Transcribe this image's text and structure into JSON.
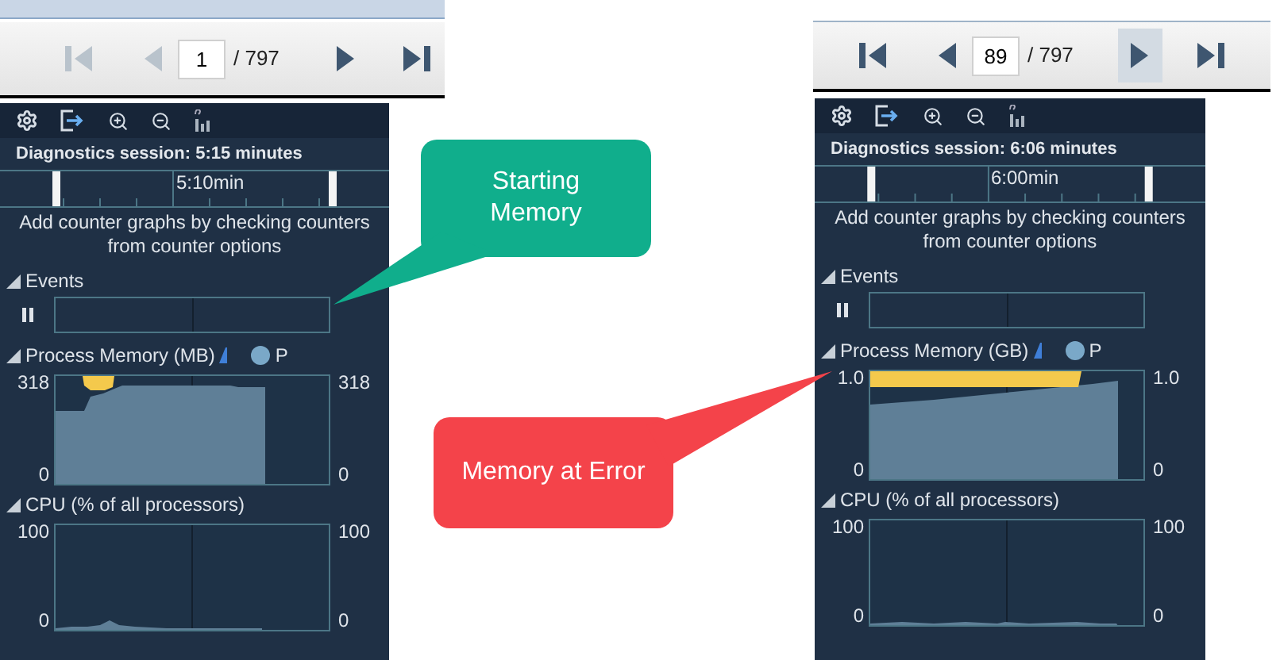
{
  "panels": [
    {
      "pager": {
        "page": "1",
        "total": "/ 797",
        "buttons": [
          {
            "kind": "first",
            "disabled": true,
            "highlighted": false
          },
          {
            "kind": "prev",
            "disabled": true,
            "highlighted": false
          },
          {
            "kind": "next",
            "disabled": false,
            "highlighted": false
          },
          {
            "kind": "last",
            "disabled": false,
            "highlighted": false
          }
        ]
      },
      "session": "Diagnostics session: 5:15 minutes",
      "timeline_label": "5:10min",
      "hint": "Add counter graphs by checking counters from counter options",
      "events_title": "Events",
      "graphs": [
        {
          "kind": "memory",
          "title": "Process Memory (MB)",
          "legend": "P",
          "left_max": "318",
          "left_min": "0",
          "right_max": "318",
          "right_min": "0"
        },
        {
          "kind": "cpu",
          "title": "CPU (% of all processors)",
          "left_max": "100",
          "left_min": "0",
          "right_max": "100",
          "right_min": "0"
        }
      ]
    },
    {
      "pager": {
        "page": "89",
        "total": "/ 797",
        "buttons": [
          {
            "kind": "first",
            "disabled": false,
            "highlighted": false
          },
          {
            "kind": "prev",
            "disabled": false,
            "highlighted": false
          },
          {
            "kind": "next",
            "disabled": false,
            "highlighted": true
          },
          {
            "kind": "last",
            "disabled": false,
            "highlighted": false
          }
        ]
      },
      "session": "Diagnostics session: 6:06 minutes",
      "timeline_label": "6:00min",
      "hint": "Add counter graphs by checking counters from counter options",
      "events_title": "Events",
      "graphs": [
        {
          "kind": "memory",
          "title": "Process Memory (GB)",
          "legend": "P",
          "left_max": "1.0",
          "left_min": "0",
          "right_max": "1.0",
          "right_min": "0"
        },
        {
          "kind": "cpu",
          "title": "CPU (% of all processors)",
          "left_max": "100",
          "left_min": "0",
          "right_max": "100",
          "right_min": "0"
        }
      ]
    }
  ],
  "callouts": [
    {
      "text": "Starting Memory",
      "color": "#10ae8c"
    },
    {
      "text": "Memory at Error",
      "color": "#f4434a"
    }
  ]
}
